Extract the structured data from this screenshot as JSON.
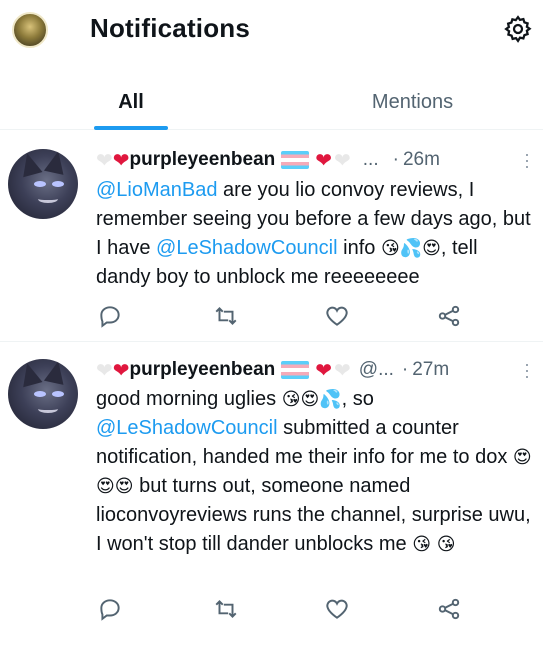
{
  "header": {
    "title": "Notifications",
    "avatar_icon": "user-avatar-icon",
    "settings_icon": "gear-icon"
  },
  "tabs": [
    {
      "label": "All",
      "active": true
    },
    {
      "label": "Mentions",
      "active": false
    }
  ],
  "accent_color": "#1d9bf0",
  "tweets": [
    {
      "display_name": "purpleyeenbean",
      "handle": "...",
      "dot": "·",
      "time": "26m",
      "text": {
        "m1": "@LioManBad",
        "t1": " are you lio convoy reviews, I remember seeing you before a few days ago, but I have ",
        "m2": "@LeShadowCouncil",
        "t2": " info ",
        "emoji1": "😘💦😍",
        "t3": ", tell dandy boy to unblock me reeeeeeee"
      }
    },
    {
      "display_name": "purpleyeenbean",
      "handle": "@...",
      "dot": "·",
      "time": "27m",
      "text": {
        "t0": "good morning uglies ",
        "emoji0": "😘😍💦",
        "t0b": ", so ",
        "m1": "@LeShadowCouncil",
        "t1": " submitted a counter notification, handed me their info for me to dox ",
        "emoji1": "😍😍😍",
        "t2": " but turns out, someone named lioconvoyreviews runs the channel, surprise uwu, I won't stop till dander unblocks me ",
        "emoji2": "😘 😘"
      }
    }
  ],
  "action_icons": [
    "reply-icon",
    "retweet-icon",
    "like-icon",
    "share-icon"
  ]
}
